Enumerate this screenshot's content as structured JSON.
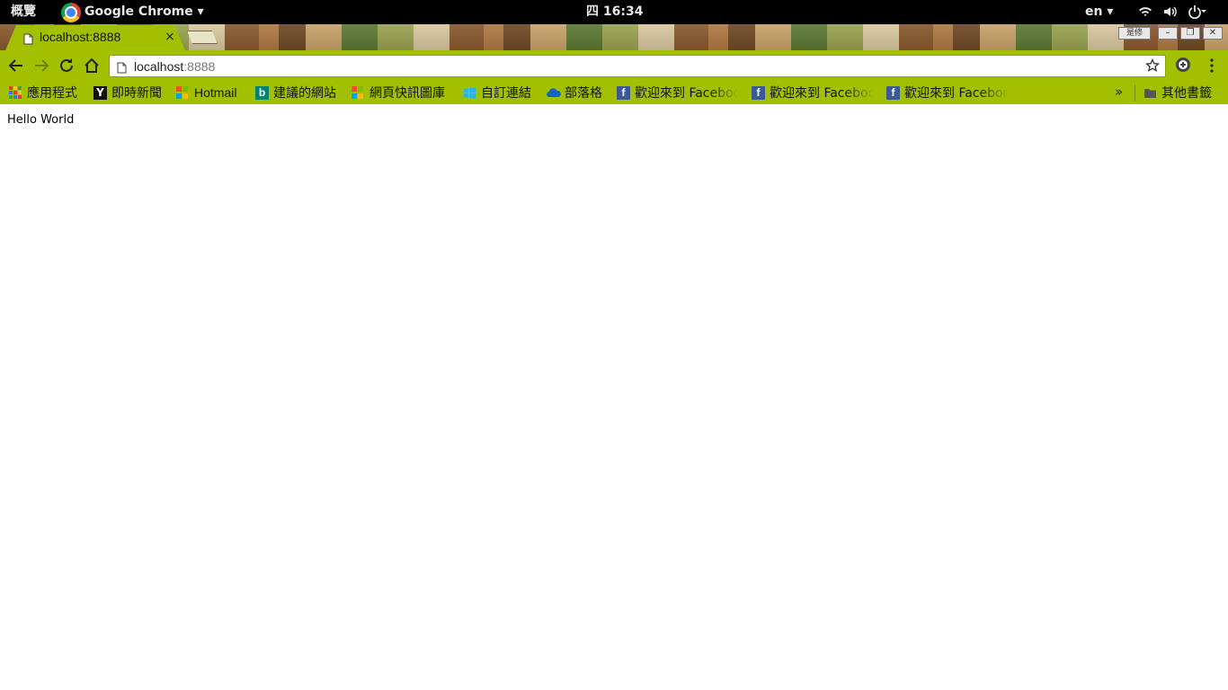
{
  "system_bar": {
    "activities": "概覽",
    "app_menu": "Google Chrome ▾",
    "clock": "四 16:34",
    "language": "en ▾"
  },
  "browser": {
    "tab": {
      "title": "localhost:8888",
      "close": "×"
    },
    "window_buttons": {
      "profile": "是修",
      "minimize": "–",
      "maximize": "❐",
      "close": "✕"
    },
    "address": {
      "host": "localhost",
      "port": ":8888"
    },
    "bookmarks": {
      "apps": "應用程式",
      "news": "即時新聞",
      "hotmail": "Hotmail",
      "suggested": "建議的網站",
      "gallery": "網頁快訊圖庫",
      "custom": "自訂連結",
      "blog": "部落格",
      "facebook_1": "歡迎來到 Facebook",
      "facebook_2": "歡迎來到 Facebook",
      "facebook_3": "歡迎來到 Facebook",
      "overflow": "»",
      "other": "其他書籤"
    },
    "colors": {
      "theme": "#a2c000",
      "facebook": "#3b5998"
    }
  },
  "page": {
    "content": "Hello World"
  }
}
